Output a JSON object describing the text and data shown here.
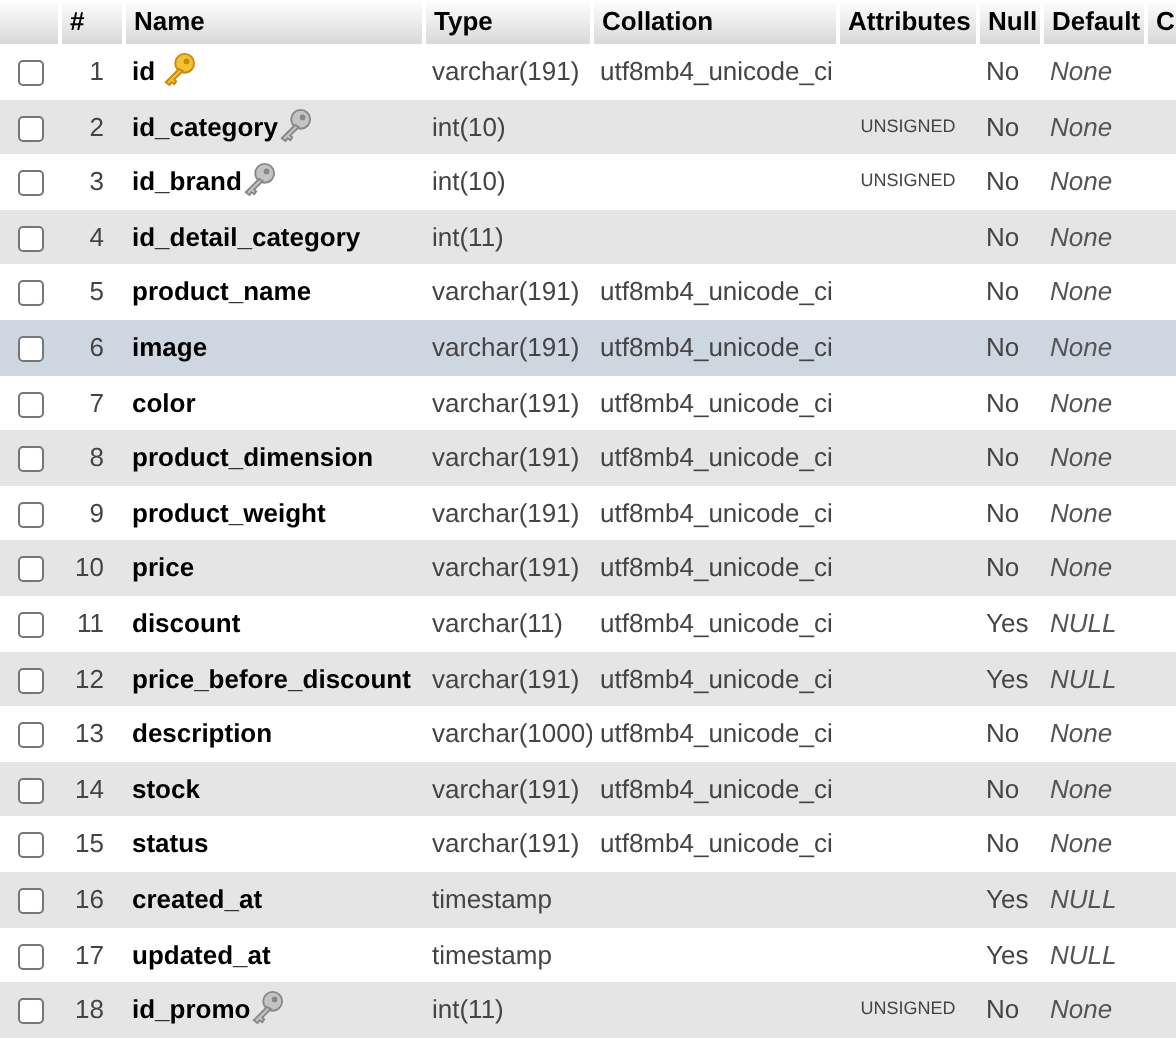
{
  "columns": [
    "#",
    "Name",
    "Type",
    "Collation",
    "Attributes",
    "Null",
    "Default",
    "C"
  ],
  "rows": [
    {
      "number": "1",
      "name": "id",
      "kind": "primary",
      "type": "varchar(191)",
      "collation": "utf8mb4_unicode_ci",
      "null": "No",
      "default": "None",
      "checked": false,
      "highlighted": false
    },
    {
      "number": "2",
      "name": "id_category",
      "kind": "indexed",
      "type": "int(10)",
      "attributes": "UNSIGNED",
      "null": "No",
      "default": "None",
      "checked": false,
      "highlighted": false
    },
    {
      "number": "3",
      "name": "id_brand",
      "kind": "indexed",
      "type": "int(10)",
      "attributes": "UNSIGNED",
      "null": "No",
      "default": "None",
      "checked": false,
      "highlighted": false
    },
    {
      "number": "4",
      "name": "id_detail_category",
      "type": "int(11)",
      "null": "No",
      "default": "None",
      "checked": false,
      "highlighted": false
    },
    {
      "number": "5",
      "name": "product_name",
      "type": "varchar(191)",
      "collation": "utf8mb4_unicode_ci",
      "null": "No",
      "default": "None",
      "checked": false,
      "highlighted": false
    },
    {
      "number": "6",
      "name": "image",
      "type": "varchar(191)",
      "collation": "utf8mb4_unicode_ci",
      "null": "No",
      "default": "None",
      "checked": false,
      "highlighted": true
    },
    {
      "number": "7",
      "name": "color",
      "type": "varchar(191)",
      "collation": "utf8mb4_unicode_ci",
      "null": "No",
      "default": "None",
      "checked": false,
      "highlighted": false
    },
    {
      "number": "8",
      "name": "product_dimension",
      "type": "varchar(191)",
      "collation": "utf8mb4_unicode_ci",
      "null": "No",
      "default": "None",
      "checked": false,
      "highlighted": false
    },
    {
      "number": "9",
      "name": "product_weight",
      "type": "varchar(191)",
      "collation": "utf8mb4_unicode_ci",
      "null": "No",
      "default": "None",
      "checked": false,
      "highlighted": false
    },
    {
      "number": "10",
      "name": "price",
      "type": "varchar(191)",
      "collation": "utf8mb4_unicode_ci",
      "null": "No",
      "default": "None",
      "checked": false,
      "highlighted": false
    },
    {
      "number": "11",
      "name": "discount",
      "type": "varchar(11)",
      "collation": "utf8mb4_unicode_ci",
      "null": "Yes",
      "default": "NULL",
      "checked": false,
      "highlighted": false
    },
    {
      "number": "12",
      "name": "price_before_discount",
      "type": "varchar(191)",
      "collation": "utf8mb4_unicode_ci",
      "null": "Yes",
      "default": "NULL",
      "checked": false,
      "highlighted": false
    },
    {
      "number": "13",
      "name": "description",
      "type": "varchar(1000)",
      "collation": "utf8mb4_unicode_ci",
      "null": "No",
      "default": "None",
      "checked": false,
      "highlighted": false
    },
    {
      "number": "14",
      "name": "stock",
      "type": "varchar(191)",
      "collation": "utf8mb4_unicode_ci",
      "null": "No",
      "default": "None",
      "checked": false,
      "highlighted": false
    },
    {
      "number": "15",
      "name": "status",
      "type": "varchar(191)",
      "collation": "utf8mb4_unicode_ci",
      "null": "No",
      "default": "None",
      "checked": false,
      "highlighted": false
    },
    {
      "number": "16",
      "name": "created_at",
      "type": "timestamp",
      "null": "Yes",
      "default": "NULL",
      "checked": false,
      "highlighted": false
    },
    {
      "number": "17",
      "name": "updated_at",
      "type": "timestamp",
      "null": "Yes",
      "default": "NULL",
      "checked": false,
      "highlighted": false
    },
    {
      "number": "18",
      "name": "id_promo",
      "kind": "indexed",
      "type": "int(11)",
      "attributes": "UNSIGNED",
      "null": "No",
      "default": "None",
      "checked": false,
      "highlighted": false
    }
  ]
}
